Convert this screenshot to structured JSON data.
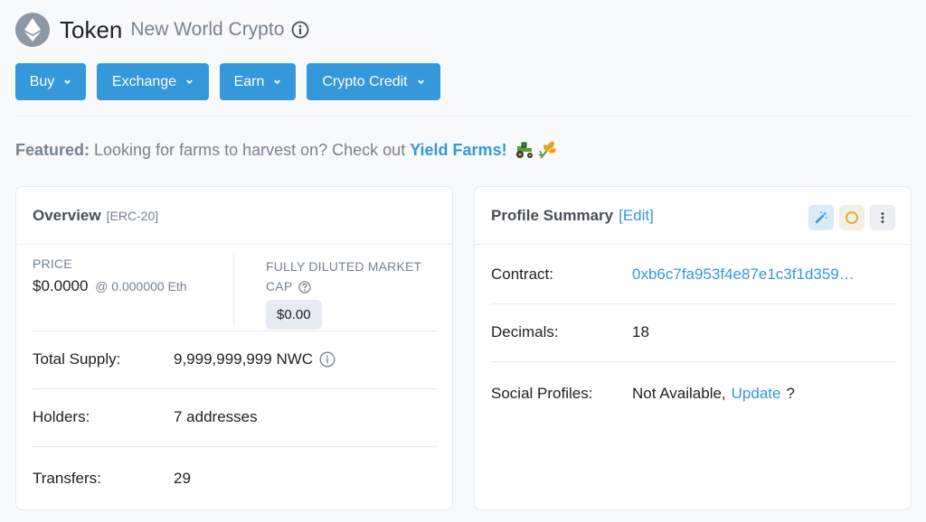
{
  "header": {
    "title": "Token",
    "subtitle": "New World Crypto"
  },
  "buttons": [
    {
      "label": "Buy"
    },
    {
      "label": "Exchange"
    },
    {
      "label": "Earn"
    },
    {
      "label": "Crypto Credit"
    }
  ],
  "featured": {
    "prefix": "Featured:",
    "message": "Looking for farms to harvest on? Check out",
    "link": "Yield Farms!"
  },
  "overview": {
    "title": "Overview",
    "tag": "[ERC-20]",
    "price_label": "PRICE",
    "price_value": "$0.0000",
    "price_eth": "@ 0.000000 Eth",
    "fdmc_label": "FULLY DILUTED MARKET CAP",
    "fdmc_value": "$0.00",
    "rows": [
      {
        "label": "Total Supply:",
        "value": "9,999,999,999 NWC"
      },
      {
        "label": "Holders:",
        "value": "7 addresses"
      },
      {
        "label": "Transfers:",
        "value": "29"
      }
    ]
  },
  "profile": {
    "title": "Profile Summary",
    "edit": "[Edit]",
    "rows": [
      {
        "label": "Contract:",
        "value": "0xb6c7fa953f4e87e1c3f1d359…"
      },
      {
        "label": "Decimals:",
        "value": "18"
      },
      {
        "label": "Social Profiles:",
        "value": "Not Available,",
        "link": "Update",
        "suffix": "?"
      }
    ]
  },
  "colors": {
    "accent": "#3498db",
    "muted": "#77838f",
    "border": "#e7eaf3"
  }
}
